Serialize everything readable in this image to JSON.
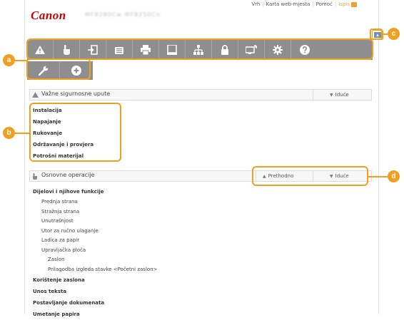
{
  "header": {
    "logo": "Canon",
    "links": [
      "Vrh",
      "Karta web-mjesta",
      "Pomoć",
      "Ispis"
    ]
  },
  "toolbar": {
    "icons_row1": [
      "warning-icon",
      "hand-icon",
      "login-icon",
      "fax-icon",
      "printer-icon",
      "scanner-icon",
      "network-icon",
      "lock-icon",
      "remote-ui-icon",
      "gear-icon",
      "help-icon"
    ],
    "icons_row2": [
      "wrench-icon",
      "plus-circle-icon"
    ],
    "bar_color": "#8e8e8e"
  },
  "sections": {
    "safety": {
      "title": "Važne sigurnosne upute",
      "next": "Iduće",
      "items": [
        "Instalacija",
        "Napajanje",
        "Rukovanje",
        "Održavanje i provjera",
        "Potrošni materijal"
      ]
    },
    "basic": {
      "title": "Osnovne operacije",
      "prev": "Prethodno",
      "next": "Iduće",
      "group_title": "Dijelovi i njihove funkcije",
      "subitems": [
        "Prednja strana",
        "Stražnja strana",
        "Unutrašnjost",
        "Utor za ručno ulaganje",
        "Ladica za papir",
        "Upravljačka ploča"
      ],
      "subsubitems": [
        "Zaslon",
        "Prilagodba izgleda stavke <Početni zaslon>"
      ],
      "more_items": [
        "Korištenje zaslona",
        "Unos teksta",
        "Postavljanje dokumenata",
        "Umetanje papira"
      ]
    }
  },
  "callouts": [
    "a",
    "b",
    "c",
    "d"
  ],
  "accent_color": "#f0a020"
}
